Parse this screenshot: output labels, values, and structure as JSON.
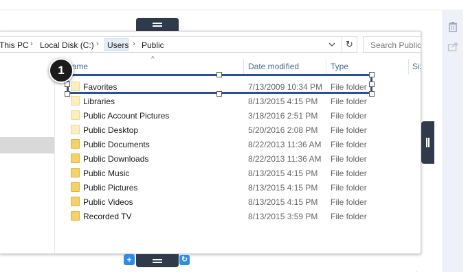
{
  "breadcrumb": {
    "items": [
      "This PC",
      "Local Disk (C:)",
      "Users",
      "Public"
    ],
    "separator": "›"
  },
  "search": {
    "placeholder": "Search Public"
  },
  "columns": [
    "Name",
    "Date modified",
    "Type",
    "Size"
  ],
  "files": [
    {
      "name": "Favorites",
      "date": "7/13/2009 10:34 PM",
      "type": "File folder",
      "pale": true
    },
    {
      "name": "Libraries",
      "date": "8/13/2015 4:15 PM",
      "type": "File folder",
      "pale": true
    },
    {
      "name": "Public Account Pictures",
      "date": "3/18/2016 2:51 PM",
      "type": "File folder",
      "pale": true
    },
    {
      "name": "Public Desktop",
      "date": "5/20/2016 2:08 PM",
      "type": "File folder",
      "pale": true
    },
    {
      "name": "Public Documents",
      "date": "8/22/2013 11:36 AM",
      "type": "File folder",
      "pale": false
    },
    {
      "name": "Public Downloads",
      "date": "8/22/2013 11:36 AM",
      "type": "File folder",
      "pale": false
    },
    {
      "name": "Public Music",
      "date": "8/13/2015 4:15 PM",
      "type": "File folder",
      "pale": false
    },
    {
      "name": "Public Pictures",
      "date": "8/13/2015 4:15 PM",
      "type": "File folder",
      "pale": false
    },
    {
      "name": "Public Videos",
      "date": "8/13/2015 4:15 PM",
      "type": "File folder",
      "pale": false
    },
    {
      "name": "Recorded TV",
      "date": "8/13/2015 3:59 PM",
      "type": "File folder",
      "pale": false
    }
  ],
  "annotation": {
    "step_number": "1"
  },
  "editor": {
    "add_label": "+",
    "refresh_label": "↻"
  },
  "icons": [
    "trash-icon",
    "share-icon",
    "refresh-icon",
    "chevron-down-icon",
    "folder-icon",
    "resize-grip-icon",
    "drag-handle-icon"
  ],
  "colors": {
    "highlight_border": "#2d4f93",
    "handle_bg": "#2f3b4b",
    "accent": "#2d8ce6",
    "folder": "#f3d16b"
  }
}
